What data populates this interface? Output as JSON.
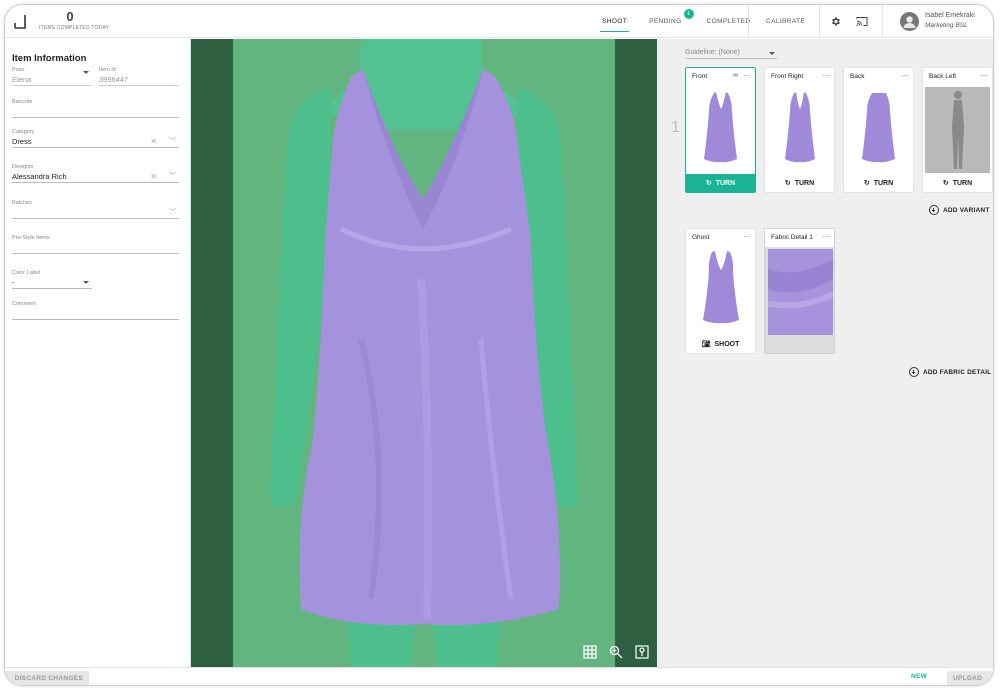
{
  "header": {
    "items_count": "0",
    "items_label": "ITEMS COMPLETED TODAY",
    "tabs": [
      {
        "label": "SHOOT",
        "active": true
      },
      {
        "label": "PENDING",
        "badge": "1"
      },
      {
        "label": "COMPLETED"
      }
    ],
    "calibrate": "CALIBRATE",
    "user_name": "Isabel Emekraki",
    "user_role": "Marketing BSL",
    "icons": [
      "settings-icon",
      "cast-icon",
      "account-icon"
    ]
  },
  "item_info": {
    "title": "Item Information",
    "pose_label": "Pose",
    "pose_value": "Elena",
    "item_id_label": "Item Id",
    "item_id_value": "3996447",
    "barcode_label": "Barcode",
    "barcode_value": "",
    "category_label": "Category",
    "category_value": "Dress",
    "designer_label": "Designer",
    "designer_value": "Alessandra Rich",
    "batches_label": "Batches",
    "batches_value": "",
    "prestyle_label": "Pre-Style Items",
    "prestyle_value": "",
    "color_label_label": "Color Label",
    "color_label_value": "-",
    "comment_label": "Comment",
    "comment_value": ""
  },
  "viewer": {
    "tools": [
      "grid-icon",
      "zoom-icon",
      "focus-icon"
    ]
  },
  "shots": {
    "guideline": "Guideline: (None)",
    "row_number": "1",
    "angles": [
      {
        "name": "Front",
        "action": "TURN",
        "selected": true
      },
      {
        "name": "Front Right",
        "action": "TURN"
      },
      {
        "name": "Back",
        "action": "TURN"
      },
      {
        "name": "Back Left",
        "action": "TURN"
      }
    ],
    "add_variant": "ADD VARIANT",
    "details": [
      {
        "name": "Ghost",
        "action": "SHOOT"
      },
      {
        "name": "Fabric Detail 1"
      }
    ],
    "add_fabric_detail": "ADD FABRIC DETAIL"
  },
  "footer": {
    "discard": "DISCARD CHANGES",
    "new": "NEW",
    "upload": "UPLOAD"
  },
  "colors": {
    "accent": "#1ab394",
    "backdrop": "#62b57e",
    "mannequin": "#4dbf8c",
    "dress": "#a592dc"
  }
}
